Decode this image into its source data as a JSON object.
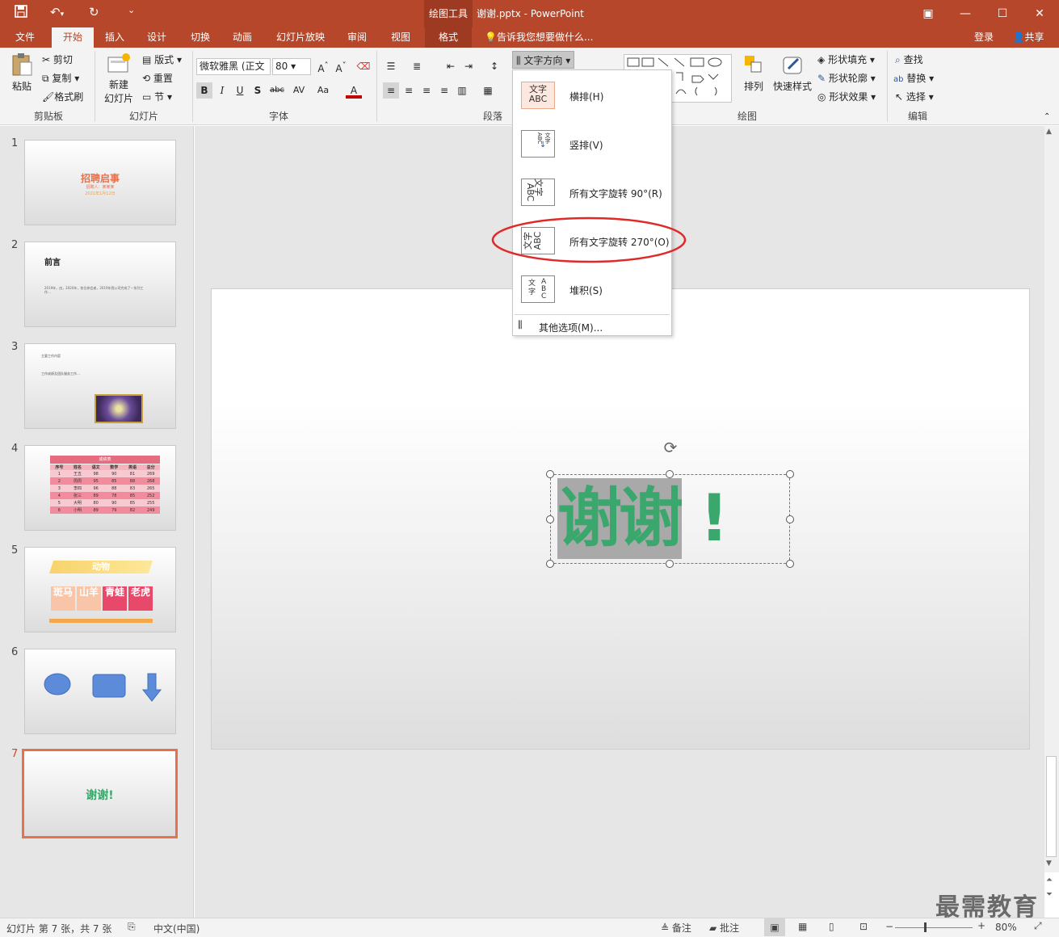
{
  "titlebar": {
    "context_group": "绘图工具",
    "document_title": "谢谢.pptx - PowerPoint",
    "icons": [
      "save-icon",
      "undo-icon",
      "redo-icon",
      "customize-icon"
    ],
    "window_buttons": [
      "ribbon-display-icon",
      "minimize-icon",
      "maximize-icon",
      "close-icon"
    ]
  },
  "tabs": {
    "items": [
      "文件",
      "开始",
      "插入",
      "设计",
      "切换",
      "动画",
      "幻灯片放映",
      "审阅",
      "视图",
      "格式"
    ],
    "active": "开始",
    "tell_me": "告诉我您想要做什么...",
    "signin": "登录",
    "share": "共享"
  },
  "ribbon": {
    "clipboard": {
      "paste": "粘贴",
      "cut": "剪切",
      "copy": "复制",
      "format_painter": "格式刷",
      "label": "剪贴板"
    },
    "slides": {
      "new_slide_1": "新建",
      "new_slide_2": "幻灯片",
      "layout": "版式",
      "reset": "重置",
      "section": "节",
      "label": "幻灯片"
    },
    "font": {
      "font_name": "微软雅黑 (正文",
      "font_size": "80",
      "label": "字体",
      "bold": "B",
      "italic": "I",
      "underline": "U",
      "shadow": "S",
      "strike": "abc",
      "spacing": "AV",
      "case": "Aa",
      "color": "A"
    },
    "paragraph": {
      "text_direction": "文字方向",
      "label": "段落"
    },
    "drawing": {
      "arrange": "排列",
      "quick_styles": "快速样式",
      "shape_fill": "形状填充",
      "shape_outline": "形状轮廓",
      "shape_effects": "形状效果",
      "label": "绘图"
    },
    "editing": {
      "find": "查找",
      "replace": "替换",
      "select": "选择",
      "label": "编辑"
    }
  },
  "text_direction_menu": {
    "items": [
      {
        "label": "横排(H)",
        "icon": "horizontal-text-icon",
        "glyph_1": "文字",
        "glyph_2": "ABC"
      },
      {
        "label": "竖排(V)",
        "icon": "vertical-text-icon",
        "glyph_1": "文字",
        "glyph_2": "ABC"
      },
      {
        "label": "所有文字旋转 90°(R)",
        "icon": "rotate-90-text-icon",
        "glyph_1": "文字",
        "glyph_2": "ABC"
      },
      {
        "label": "所有文字旋转 270°(O)",
        "icon": "rotate-270-text-icon",
        "glyph_1": "文字",
        "glyph_2": "ABC"
      },
      {
        "label": "堆积(S)",
        "icon": "stacked-text-icon",
        "glyph_1": "文",
        "glyph_2": "字",
        "glyph_3": "A",
        "glyph_4": "B",
        "glyph_5": "C"
      }
    ],
    "more_options": "其他选项(M)...",
    "highlighted": "所有文字旋转 270°(O)",
    "annotation_color": "#e02a2a"
  },
  "thumbnails": [
    {
      "num": "1",
      "title": "招聘启事",
      "sub1": "招聘人：某某某",
      "sub2": "2021年1月12日"
    },
    {
      "num": "2",
      "title": "前言",
      "body": "2019年，由，2020年，各位参会者，2019年我公司完成了一系列工作…"
    },
    {
      "num": "3",
      "title": "主要工作内容",
      "body": "工作成绩及团队服务工作…"
    },
    {
      "num": "4",
      "table_title": "成绩表",
      "headers": [
        "序号",
        "姓名",
        "语文",
        "数学",
        "英语",
        "总分"
      ],
      "rows": [
        [
          "1",
          "王五",
          "98",
          "90",
          "81",
          "269"
        ],
        [
          "2",
          "周周",
          "95",
          "85",
          "88",
          "268"
        ],
        [
          "3",
          "李四",
          "96",
          "88",
          "83",
          "265"
        ],
        [
          "4",
          "张三",
          "89",
          "78",
          "85",
          "252"
        ],
        [
          "5",
          "大明",
          "80",
          "90",
          "85",
          "255"
        ],
        [
          "6",
          "小明",
          "89",
          "79",
          "82",
          "249"
        ]
      ]
    },
    {
      "num": "5",
      "banner": "动物",
      "cells": [
        "斑马",
        "山羊",
        "青蛙",
        "老虎"
      ]
    },
    {
      "num": "6"
    },
    {
      "num": "7",
      "text": "谢谢!",
      "selected": true
    }
  ],
  "slide": {
    "text_main": "谢谢",
    "text_exclaim": "!",
    "text_color": "#3aa76d"
  },
  "statusbar": {
    "slide_info": "幻灯片 第 7 张，共 7 张",
    "language": "中文(中国)",
    "notes": "备注",
    "comments": "批注",
    "zoom": "80%"
  },
  "watermark": "最需教育"
}
